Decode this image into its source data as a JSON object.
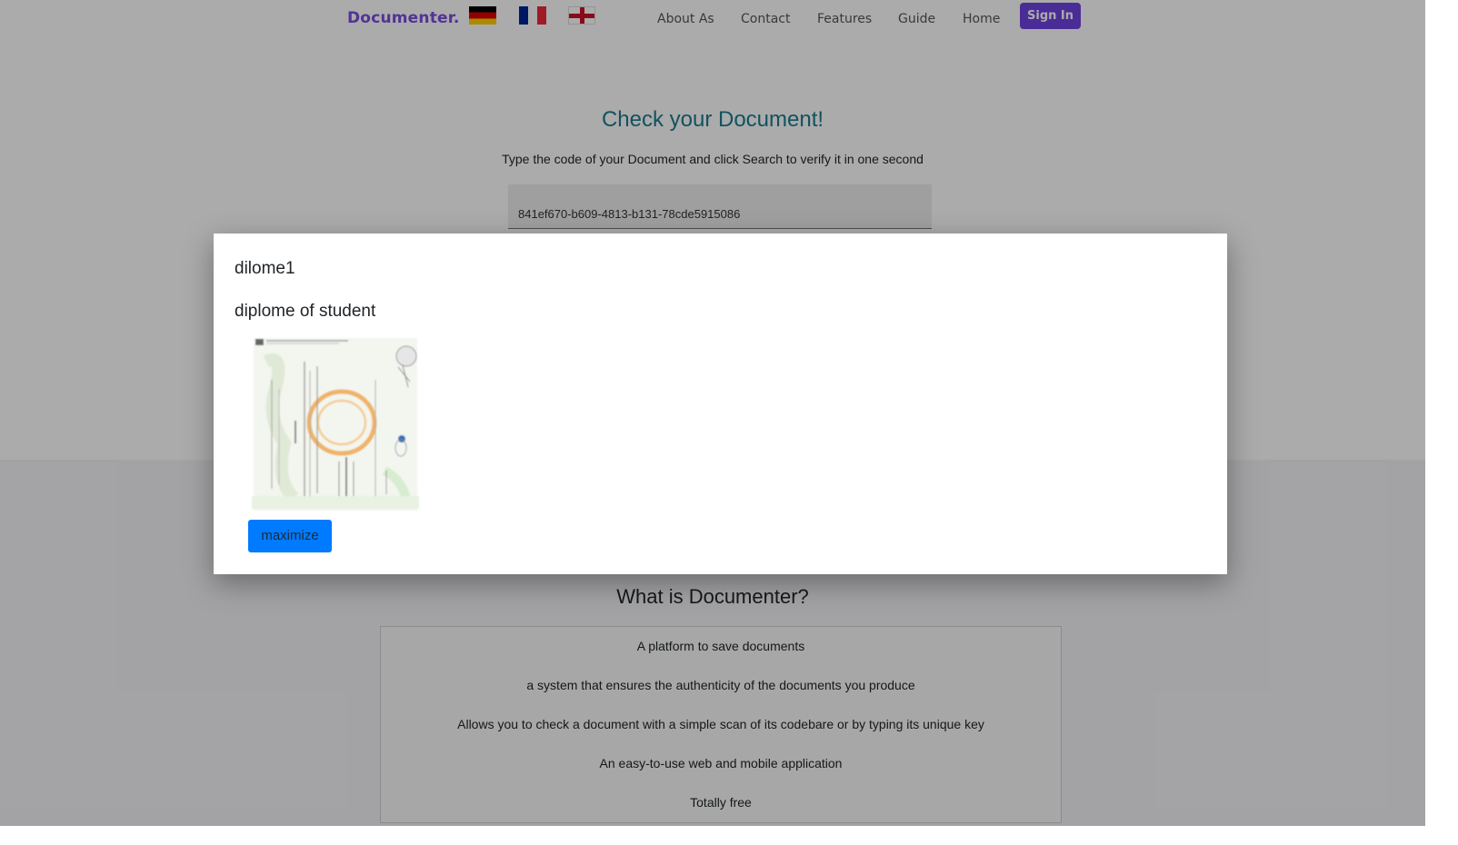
{
  "header": {
    "brand": "Documenter.",
    "flags": [
      "german-flag-icon",
      "french-flag-icon",
      "english-flag-icon"
    ],
    "nav": [
      "About As",
      "Contact",
      "Features",
      "Guide",
      "Home"
    ],
    "sign_in": "Sign In"
  },
  "hero": {
    "title": "Check your Document!",
    "subtitle": "Type the code of your Document and click Search to verify it in one second",
    "search_value": "841ef670-b609-4813-b131-78cde5915086"
  },
  "what_is": {
    "title": "What is Documenter?",
    "items": [
      "A platform to save documents",
      "a system that ensures the authenticity of the documents you produce",
      "Allows you to check a document with a simple scan of its codebare or by typing its unique key",
      "An easy-to-use web and mobile application",
      "Totally free"
    ]
  },
  "modal": {
    "title": "dilome1",
    "description": "diplome of student",
    "maximize_label": "maximize"
  },
  "colors": {
    "brand": "#7b4ce0",
    "sign_in_bg": "#6f42e0",
    "hero_title": "#1b7b8e",
    "maximize_bg": "#007bff"
  }
}
